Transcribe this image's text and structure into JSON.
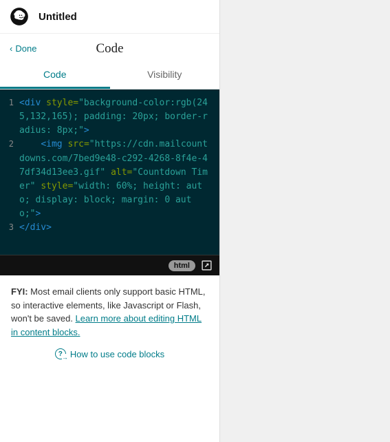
{
  "header": {
    "title": "Untitled"
  },
  "editor": {
    "done_label": "Done",
    "panel_title": "Code",
    "tabs": {
      "code": "Code",
      "visibility": "Visibility"
    },
    "footer_badge": "html",
    "lines": [
      {
        "n": "1",
        "tokens": [
          {
            "t": "tag",
            "v": "<div"
          },
          {
            "t": "txt",
            "v": " "
          },
          {
            "t": "attr",
            "v": "style"
          },
          {
            "t": "eq",
            "v": "="
          },
          {
            "t": "str",
            "v": "\"background-color:rgb(245,132,165); padding: 20px; border-radius: 8px;\""
          },
          {
            "t": "tag",
            "v": ">"
          }
        ]
      },
      {
        "n": "2",
        "tokens": [
          {
            "t": "txt",
            "v": "    "
          },
          {
            "t": "tag",
            "v": "<img"
          },
          {
            "t": "txt",
            "v": " "
          },
          {
            "t": "attr",
            "v": "src"
          },
          {
            "t": "eq",
            "v": "="
          },
          {
            "t": "str",
            "v": "\"https://cdn.mailcountdowns.com/7bed9e48-c292-4268-8f4e-47df34d13ee3.gif\""
          },
          {
            "t": "txt",
            "v": " "
          },
          {
            "t": "attr",
            "v": "alt"
          },
          {
            "t": "eq",
            "v": "="
          },
          {
            "t": "str",
            "v": "\"Countdown Timer\""
          },
          {
            "t": "txt",
            "v": " "
          },
          {
            "t": "attr",
            "v": "style"
          },
          {
            "t": "eq",
            "v": "="
          },
          {
            "t": "str",
            "v": "\"width: 60%; height: auto; display: block; margin: 0 auto;\""
          },
          {
            "t": "tag",
            "v": ">"
          }
        ]
      },
      {
        "n": "3",
        "tokens": [
          {
            "t": "tag",
            "v": "</div>"
          }
        ]
      }
    ]
  },
  "fyi": {
    "label": "FYI:",
    "body": " Most email clients only support basic HTML, so interactive elements, like Javascript or Flash, won't be saved. ",
    "link": "Learn more about editing HTML in content blocks."
  },
  "howto": {
    "label": "How to use code blocks"
  }
}
